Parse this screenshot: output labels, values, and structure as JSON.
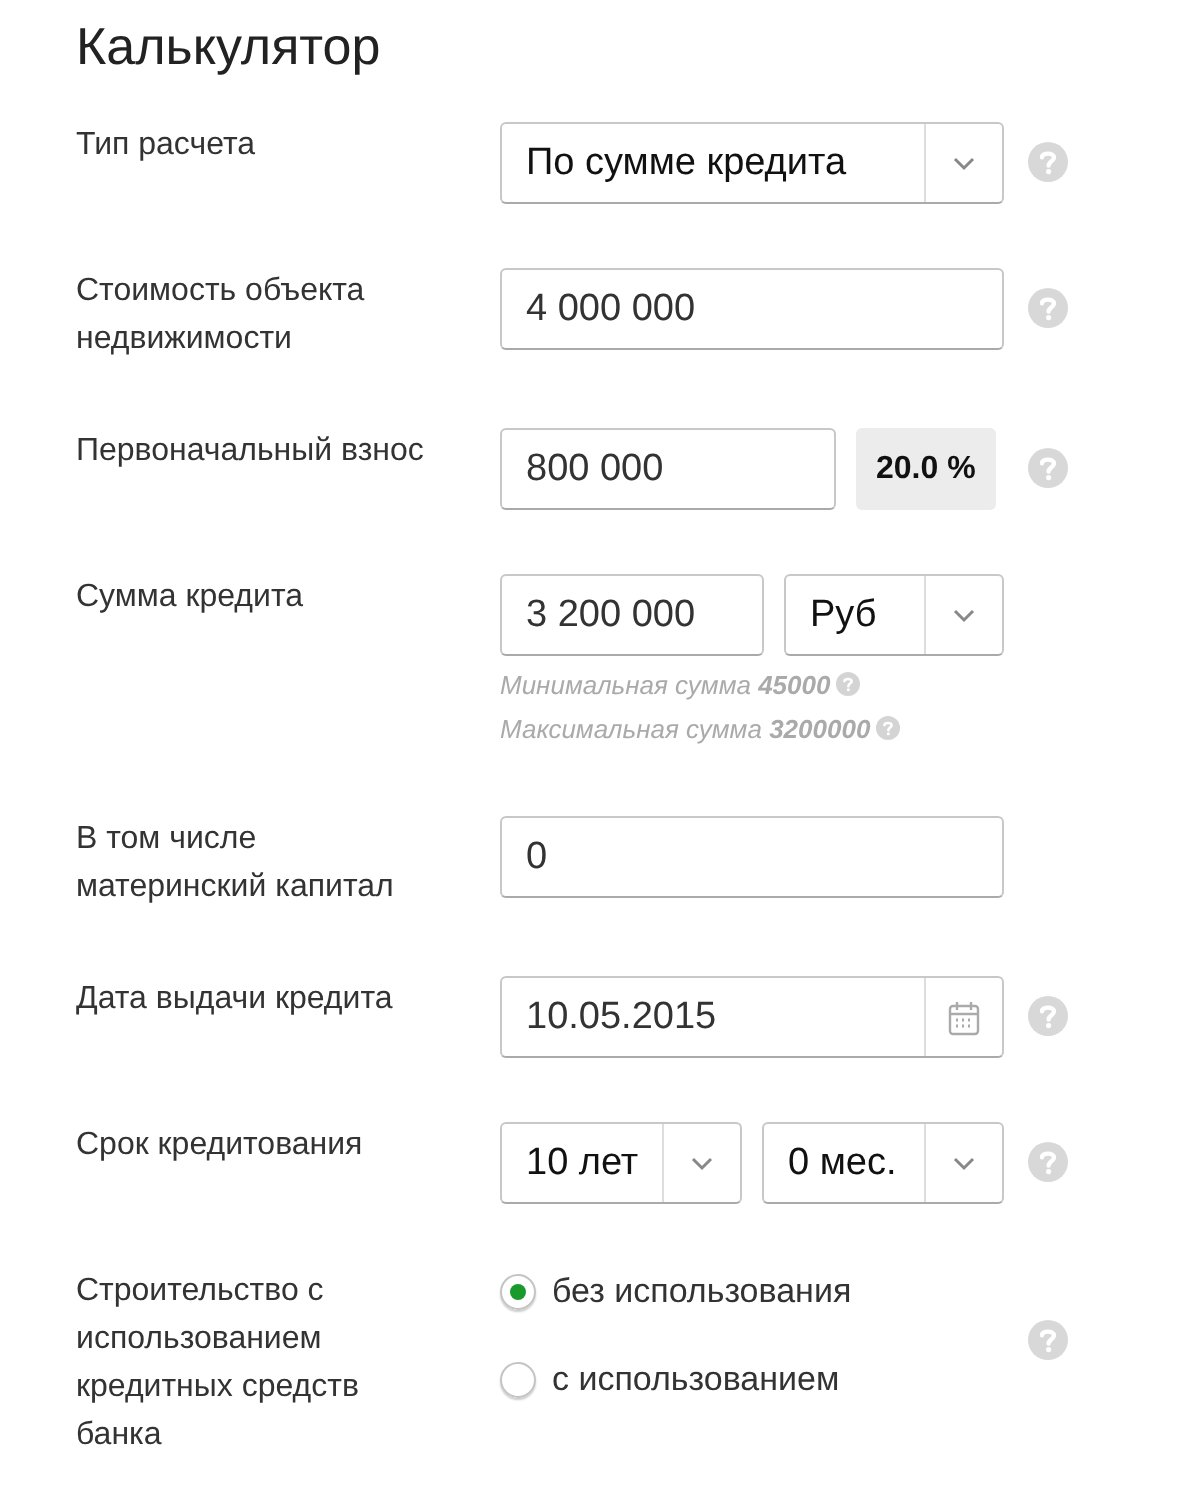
{
  "title": "Калькулятор",
  "rows": [
    {
      "label": "Тип расчета",
      "kind": "select",
      "value": "По сумме кредита",
      "help": true
    },
    {
      "label": "Стоимость объекта\nнедвижимости",
      "kind": "input",
      "value": "4 000 000",
      "help": true
    },
    {
      "label": "Первоначальный взнос",
      "kind": "input_badge",
      "value": "800 000",
      "badge": "20.0 %",
      "help": true
    },
    {
      "label": "Сумма кредита",
      "kind": "input_select",
      "value": "3 200 000",
      "select": "Руб",
      "help": false,
      "hints": [
        "Минимальная сумма **45000**",
        "Максимальная сумма **3200000**"
      ]
    },
    {
      "label": "В том числе\nматеринский капитал",
      "kind": "input",
      "value": "0",
      "help": false
    },
    {
      "label": "Дата выдачи кредита",
      "kind": "date",
      "value": "10.05.2015",
      "help": true
    },
    {
      "label": "Срок кредитования",
      "kind": "double_select",
      "selects": [
        "10 лет",
        "0 мес."
      ],
      "help": true
    },
    {
      "label": "Строительство с\nиспользованием\nкредитных средств\nбанка",
      "kind": "radio",
      "options": [
        {
          "label": "без использования",
          "selected": true
        },
        {
          "label": "с использованием",
          "selected": false
        }
      ],
      "help": true
    }
  ]
}
